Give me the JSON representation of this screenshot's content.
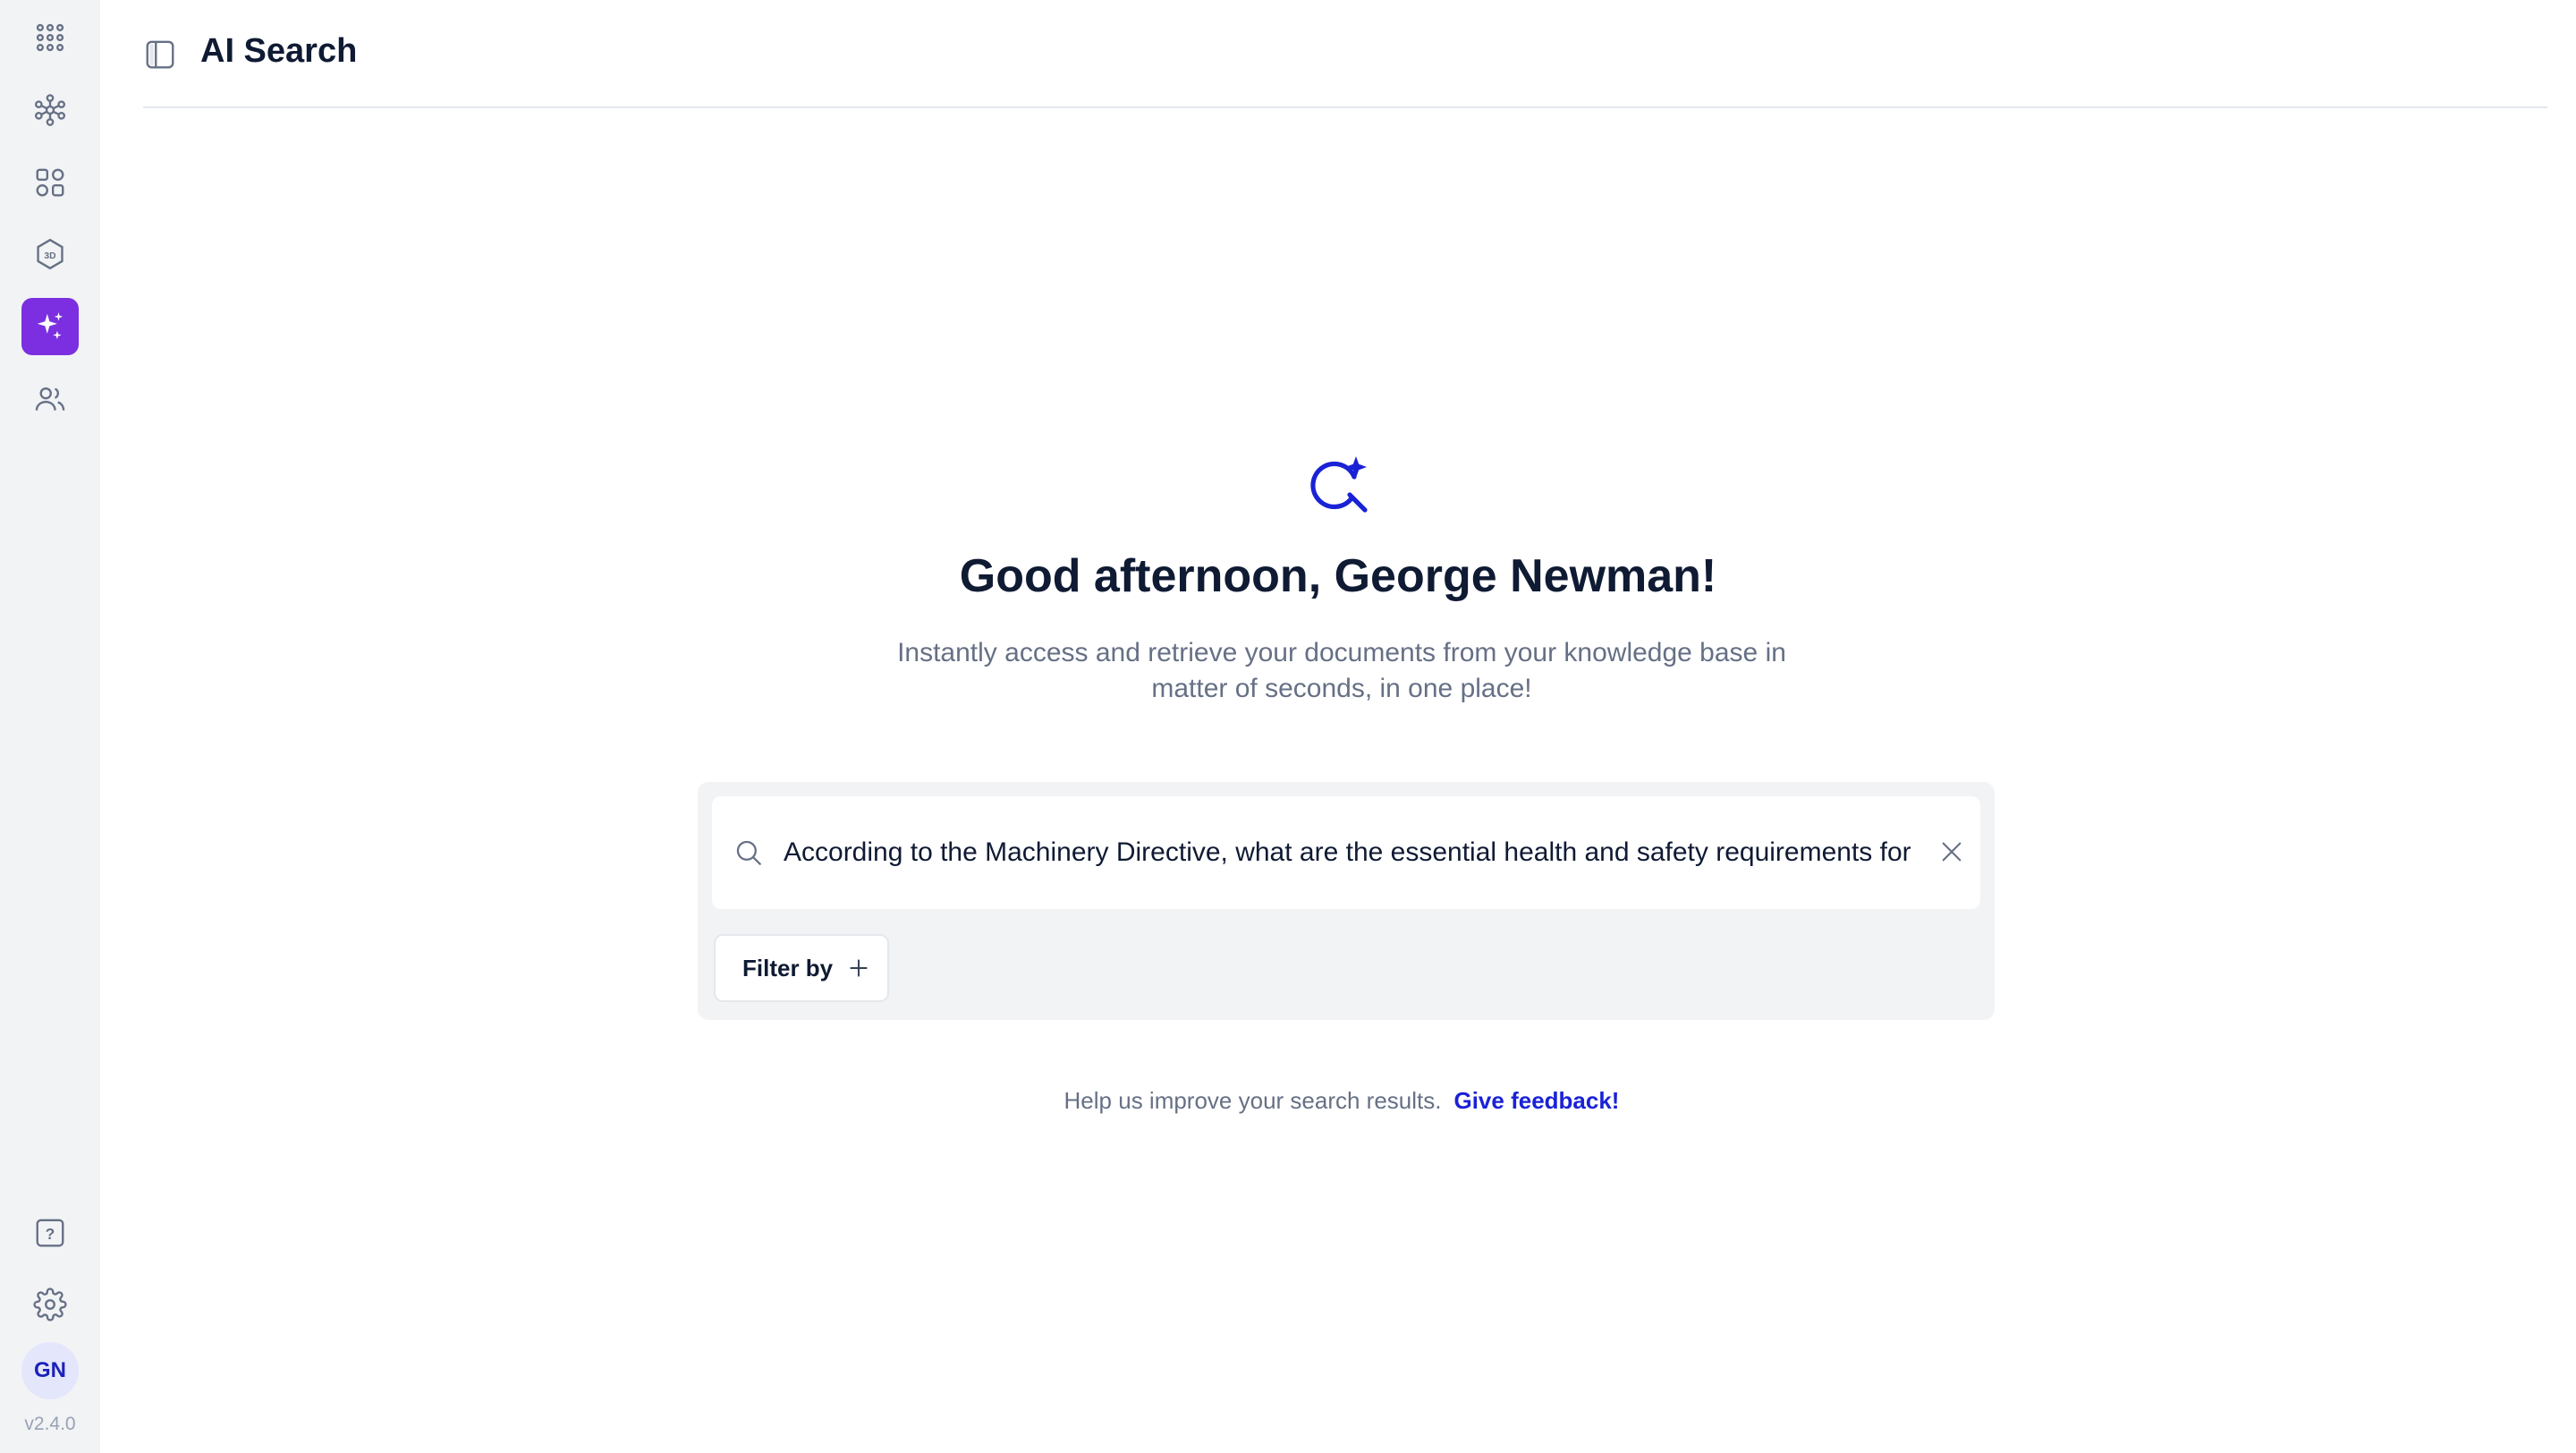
{
  "app": {
    "version": "v2.4.0"
  },
  "sidebar": {
    "items": [
      {
        "id": "apps",
        "icon": "grid-dots-icon"
      },
      {
        "id": "network",
        "icon": "molecule-icon"
      },
      {
        "id": "catalog",
        "icon": "shapes-icon"
      },
      {
        "id": "viewer-3d",
        "icon": "cube-3d-icon",
        "icon_text": "3D"
      },
      {
        "id": "ai-search",
        "icon": "sparkles-icon",
        "active": true
      },
      {
        "id": "users",
        "icon": "users-icon"
      }
    ],
    "bottom_items": [
      {
        "id": "help",
        "icon": "help-icon",
        "icon_text": "?"
      },
      {
        "id": "settings",
        "icon": "gear-icon"
      }
    ],
    "avatar_initials": "GN"
  },
  "header": {
    "title": "AI Search",
    "toggle_icon": "sidebar-toggle-icon"
  },
  "hero": {
    "icon": "ai-search-icon",
    "greeting": "Good afternoon, George Newman!",
    "subtitle_line1": "Instantly access and retrieve your documents from your knowledge base in",
    "subtitle_line2": "matter of seconds, in one place!"
  },
  "search": {
    "value": "According to the Machinery Directive, what are the essential health and safety requirements for design and construction of machinery?",
    "icon": "search-icon",
    "clear_icon": "close-icon",
    "filter_label": "Filter by",
    "filter_icon": "plus-icon"
  },
  "feedback": {
    "text": "Help us improve your search results.",
    "link_label": "Give feedback!"
  },
  "colors": {
    "accent": "#7b2fe0",
    "brand_blue": "#1a22d6",
    "sidebar_bg": "#f2f3f5",
    "text_primary": "#0f1a33",
    "text_muted": "#667085"
  }
}
